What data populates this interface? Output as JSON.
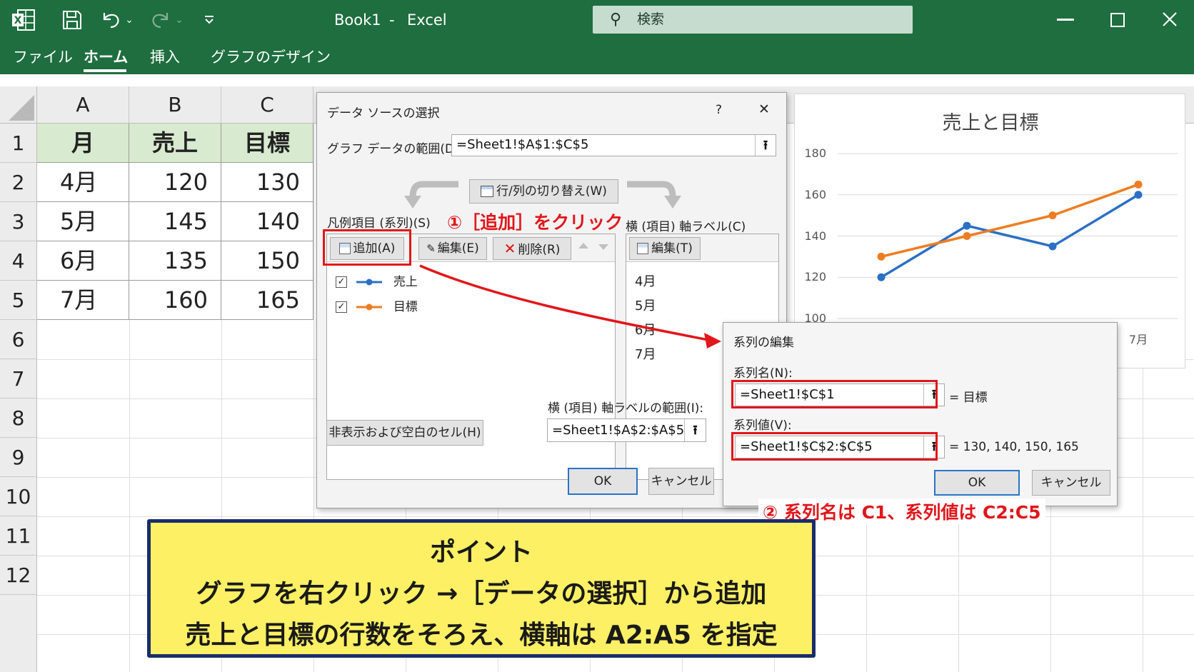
{
  "titlebar": {
    "document_title": "Book1",
    "separator": "-",
    "app_name": "Excel",
    "search_placeholder": "検索",
    "icons": [
      "excel-logo-icon",
      "save-icon",
      "undo-icon",
      "redo-icon",
      "customize-qat-icon",
      "minimize-icon",
      "maximize-icon",
      "close-icon"
    ]
  },
  "ribbon": {
    "tabs": [
      {
        "label": "ファイル",
        "active": false
      },
      {
        "label": "ホーム",
        "active": true
      },
      {
        "label": "挿入",
        "active": false
      },
      {
        "label": "グラフのデザイン",
        "active": false
      }
    ]
  },
  "sheet": {
    "columns": [
      "A",
      "B",
      "C"
    ],
    "rows": [
      "1",
      "2",
      "3",
      "4",
      "5",
      "6",
      "7",
      "8",
      "9",
      "10",
      "11",
      "12"
    ],
    "header_row": [
      "月",
      "売上",
      "目標"
    ],
    "data": [
      [
        "4月",
        "120",
        "130"
      ],
      [
        "5月",
        "145",
        "140"
      ],
      [
        "6月",
        "135",
        "150"
      ],
      [
        "7月",
        "160",
        "165"
      ]
    ]
  },
  "data_source_dialog": {
    "title": "データ ソースの選択",
    "help": "?",
    "close": "✕",
    "range_label": "グラフ データの範囲(D):",
    "range_value": "=Sheet1!$A$1:$C$5",
    "switch_button": "行/列の切り替え(W)",
    "legend_label": "凡例項目 (系列)(S)",
    "add_button": "追加(A)",
    "edit_button": "編集(E)",
    "delete_button": "削除(R)",
    "series": [
      {
        "name": "売上",
        "checked": true,
        "color": "#2b6fc7"
      },
      {
        "name": "目標",
        "checked": true,
        "color": "#ee7d22"
      }
    ],
    "axis_label": "横 (項目) 軸ラベル(C)",
    "axis_edit_button": "編集(T)",
    "axis_items": [
      "4月",
      "5月",
      "6月",
      "7月"
    ],
    "axis_range_label": "横 (項目) 軸ラベルの範囲(I):",
    "axis_range_value": "=Sheet1!$A$2:$A$5",
    "hidden_cells_button": "非表示および空白のセル(H)",
    "ok": "OK",
    "cancel": "キャンセル"
  },
  "series_edit_dialog": {
    "title": "系列の編集",
    "name_label": "系列名(N):",
    "name_value": "=Sheet1!$C$1",
    "name_preview": "= 目標",
    "values_label": "系列値(V):",
    "values_value": "=Sheet1!$C$2:$C$5",
    "values_preview": "= 130, 140, 150, 165",
    "ok": "OK",
    "cancel": "キャンセル"
  },
  "annotations": {
    "step1": "①［追加］をクリック",
    "step2": "② 系列名は C1、系列値は C2:C5",
    "point_title": "ポイント",
    "point_line1": "グラフを右クリック →［データの選択］から追加",
    "point_line2": "売上と目標の行数をそろえ、横軸は A2:A5 を指定",
    "accent": "#e2161a",
    "box_fill": "#fdf064",
    "box_border": "#1a2d6b"
  },
  "chart_data": {
    "type": "line",
    "title": "売上と目標",
    "categories": [
      "4月",
      "5月",
      "6月",
      "7月"
    ],
    "series": [
      {
        "name": "売上",
        "values": [
          120,
          145,
          135,
          160
        ],
        "color": "#2b6fc7"
      },
      {
        "name": "目標",
        "values": [
          130,
          140,
          150,
          165
        ],
        "color": "#ee7d22"
      }
    ],
    "yticks": [
      "180",
      "160",
      "140",
      "120",
      "100"
    ],
    "ylim": [
      100,
      180
    ],
    "legend_position": "bottom",
    "grid": true
  }
}
